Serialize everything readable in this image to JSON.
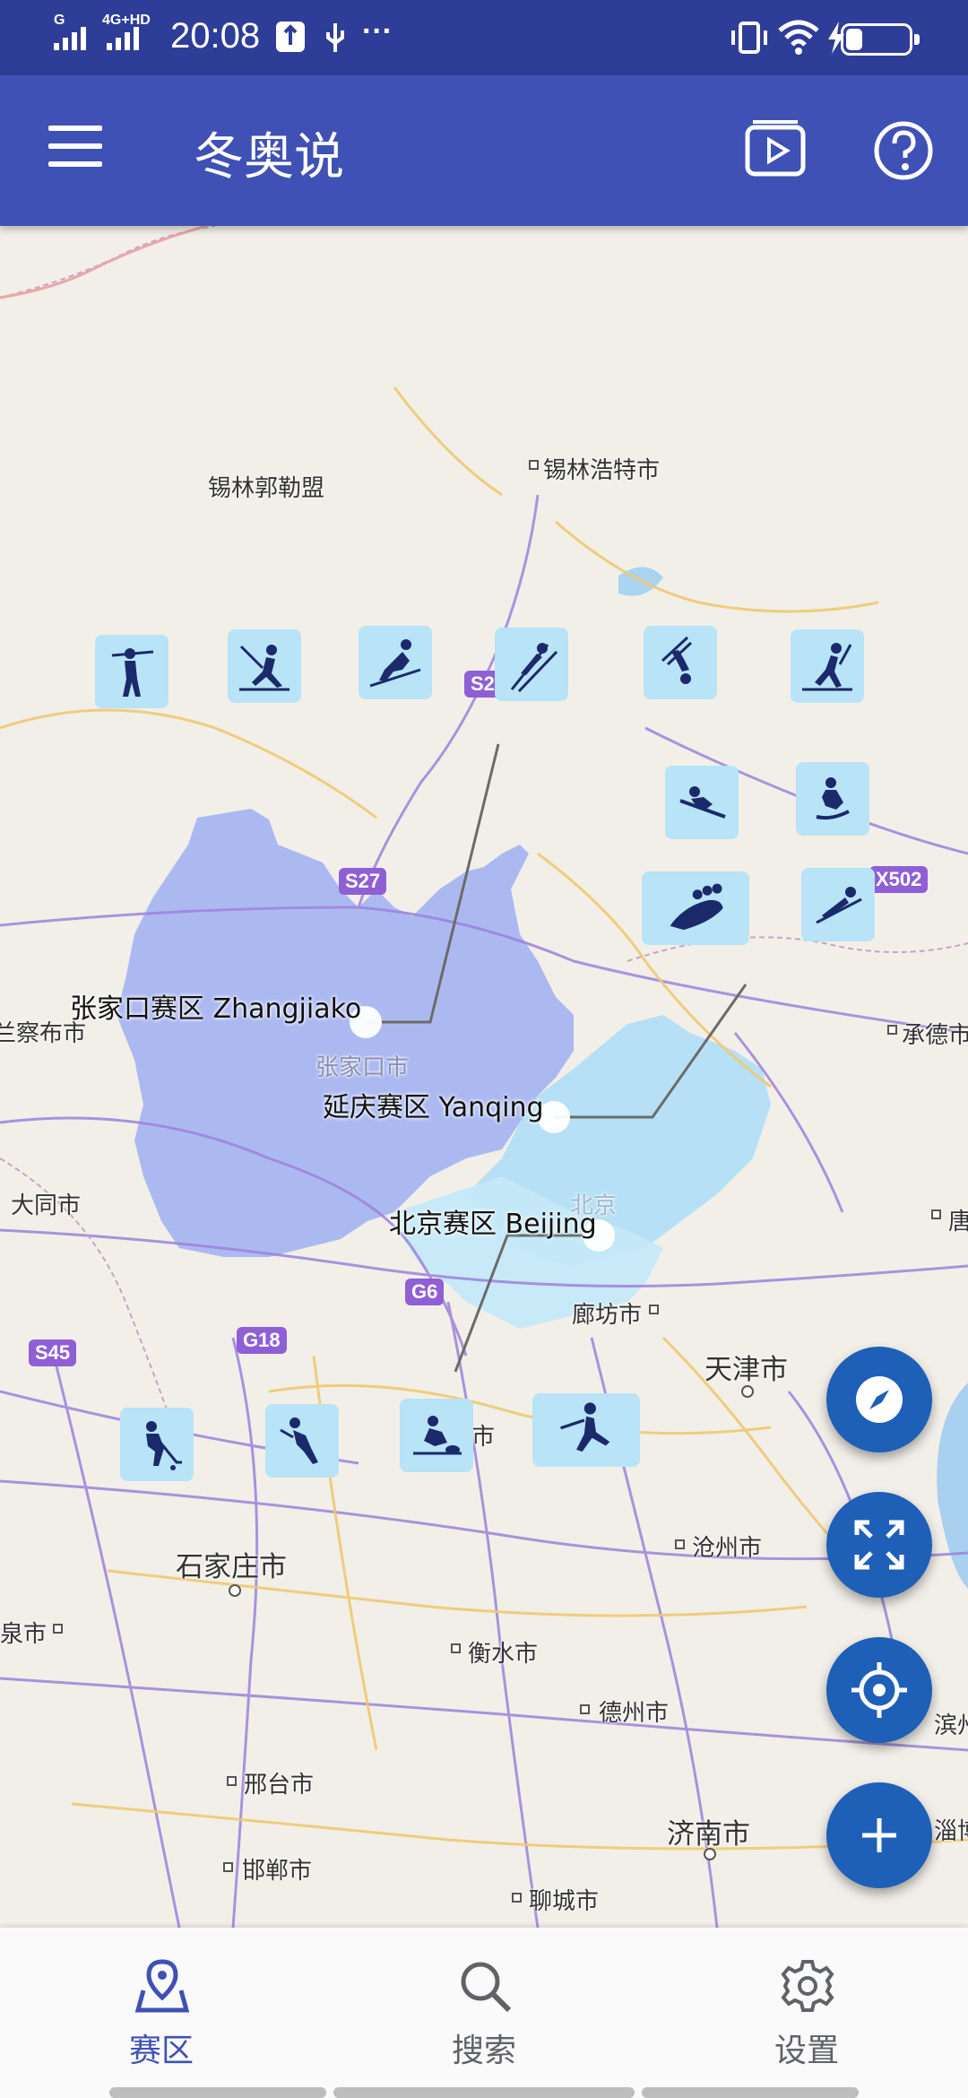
{
  "status_bar": {
    "signal_label": "4G+HD",
    "signal_left_label": "G",
    "time": "20:08",
    "battery": "25",
    "more": "···"
  },
  "app_bar": {
    "title": "冬奥说",
    "menu_icon": "menu-icon",
    "video_icon": "video-icon",
    "help_icon": "help-icon"
  },
  "map": {
    "cities": [
      {
        "name": "锡林郭勒盟"
      },
      {
        "name": "锡林浩特市"
      },
      {
        "name": "兰察布市"
      },
      {
        "name": "张家口市"
      },
      {
        "name": "承德市"
      },
      {
        "name": "大同市"
      },
      {
        "name": "北京"
      },
      {
        "name": "廊坊市"
      },
      {
        "name": "天津市"
      },
      {
        "name": "唐"
      },
      {
        "name": "石家庄市"
      },
      {
        "name": "沧州市"
      },
      {
        "name": "衡水市"
      },
      {
        "name": "德州市"
      },
      {
        "name": "泉市"
      },
      {
        "name": "邢台市"
      },
      {
        "name": "济南市"
      },
      {
        "name": "邯郸市"
      },
      {
        "name": "聊城市"
      },
      {
        "name": "滨州市"
      },
      {
        "name": "淄博"
      },
      {
        "name": "市"
      }
    ],
    "road_shields": [
      "S2",
      "S27",
      "X502",
      "G6",
      "G18",
      "S45"
    ],
    "zones": [
      {
        "label": "张家口赛区 Zhangjiako",
        "color": "#a9b6f0"
      },
      {
        "label": "延庆赛区 Yanqing",
        "color": "#b5e0f7"
      },
      {
        "label": "北京赛区 Beijing",
        "color": "#c4e6f8"
      }
    ],
    "sport_icons": [
      "biathlon-icon",
      "cross-country-skiing-icon",
      "alpine-skiing-icon",
      "ski-jumping-icon",
      "freestyle-skiing-icon",
      "nordic-combined-icon",
      "snowboard-icon",
      "skeleton-icon",
      "bobsleigh-icon",
      "luge-icon",
      "ice-hockey-icon",
      "speed-skating-icon",
      "curling-icon",
      "figure-skating-icon"
    ]
  },
  "fabs": [
    "compass-icon",
    "fullscreen-icon",
    "locate-icon",
    "add-icon"
  ],
  "bottom_nav": {
    "active_color": "#3f51b5",
    "items": [
      {
        "label": "赛区",
        "icon": "map-pin-icon",
        "active": true
      },
      {
        "label": "搜索",
        "icon": "search-icon",
        "active": false
      },
      {
        "label": "设置",
        "icon": "settings-icon",
        "active": false
      }
    ]
  }
}
